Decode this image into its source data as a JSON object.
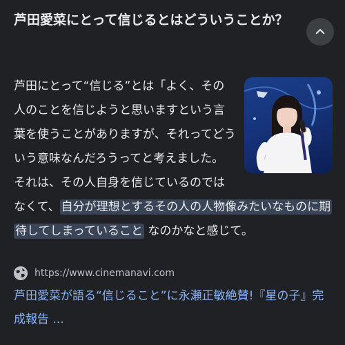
{
  "question": {
    "text": "芦田愛菜にとって信じるとはどういうことか？"
  },
  "answer": {
    "intro": "芦田にとって“信じる”とは「よく、その人のことを信じようと思いますという言葉を使うことがありますが、それってどういう意味なんだろうってと考えました。 それは、その人自身を信じているのではなくて、",
    "highlight": "自分が理想とするその人の人物像みたいなものに期待してしまっていること",
    "outro": "なのかなと感じて。"
  },
  "source": {
    "url": "https://www.cinemanavi.com",
    "title": "芦田愛菜が語る“信じること”に永瀬正敏絶賛!『星の子』完成報告 ..."
  },
  "icons": {
    "collapse": "chevron-up-icon",
    "site": "globe-icon"
  },
  "colors": {
    "background": "#202124",
    "text": "#e8eaed",
    "link": "#8ab4f8",
    "highlight": "#394457"
  }
}
